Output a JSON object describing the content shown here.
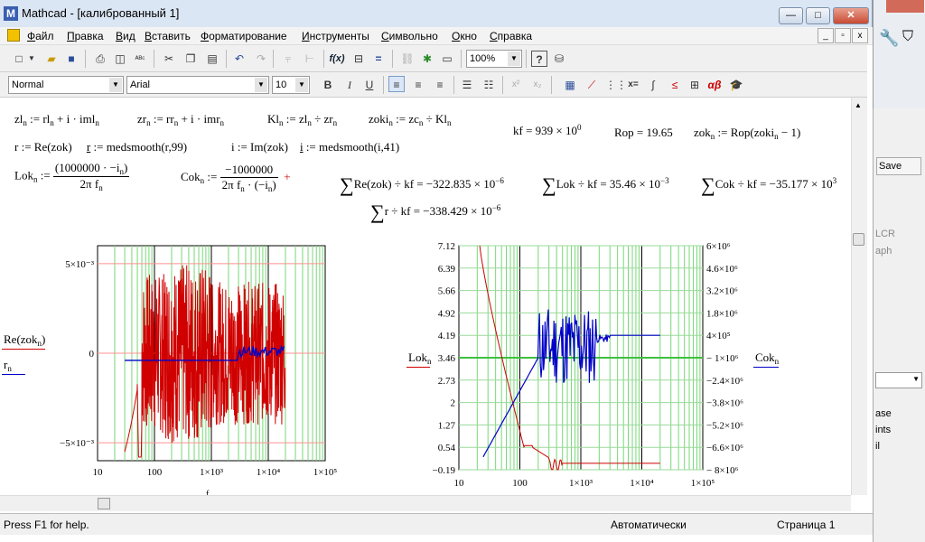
{
  "window": {
    "title": "Mathcad - [калиброванный 1]",
    "app_letter": "M",
    "min": "—",
    "max": "□",
    "close": "✕"
  },
  "menu": [
    {
      "k": "Ф",
      "r": "айл"
    },
    {
      "k": "П",
      "r": "равка"
    },
    {
      "k": "В",
      "r": "ид"
    },
    {
      "k": "В",
      "r": "ставить"
    },
    {
      "k": "Ф",
      "r": "орматирование"
    },
    {
      "k": "И",
      "r": "нструменты"
    },
    {
      "k": "С",
      "r": "имвольно"
    },
    {
      "k": "О",
      "r": "кно"
    },
    {
      "k": "С",
      "r": "правка"
    }
  ],
  "toolbar": {
    "zoom": "100%",
    "style": "Normal",
    "font": "Arial",
    "size": "10",
    "bold": "B",
    "italic": "I",
    "underline": "U"
  },
  "status": {
    "help": "Press F1 for help.",
    "mode": "Автоматически",
    "page": "Страница 1"
  },
  "browser": {
    "save": "Save",
    "lcr": "LCR",
    "aph": "aph",
    "ase": "ase",
    "ints": "ints",
    "il": "il"
  },
  "plot1": {
    "ylabel1": "Re(zok",
    "ylabel1_sub": "n",
    "ylabel2": "r",
    "ylabel2_sub": "n",
    "xlabel": "f"
  },
  "plot2": {
    "ylabel_left": "Lok",
    "ylabel_left_sub": "n",
    "ylabel_right": "Cok",
    "ylabel_right_sub": "n"
  },
  "chart_data": [
    {
      "type": "line",
      "x_scale": "log",
      "xlim": [
        10,
        100000
      ],
      "x_ticks": [
        "10",
        "100",
        "1×10³",
        "1×10⁴",
        "1×10⁵"
      ],
      "y_ticks": [
        "5×10⁻³",
        "0",
        "−5×10⁻³"
      ],
      "ylim": [
        -0.006,
        0.006
      ],
      "grid": true,
      "series": [
        {
          "name": "Re(zokn)",
          "color": "#d00000"
        },
        {
          "name": "rn",
          "color": "#0000c8"
        }
      ]
    },
    {
      "type": "line",
      "x_scale": "log",
      "xlim": [
        10,
        100000
      ],
      "x_ticks": [
        "10",
        "100",
        "1×10³",
        "1×10⁴",
        "1×10⁵"
      ],
      "y_ticks_left": [
        "7.12",
        "6.39",
        "5.66",
        "4.92",
        "4.19",
        "3.46",
        "2.73",
        "2",
        "1.27",
        "0.54",
        "−0.19"
      ],
      "y_ticks_right": [
        "6×10⁶",
        "4.6×10⁶",
        "3.2×10⁶",
        "1.8×10⁶",
        "4×10⁵",
        "− 1×10⁶",
        "−2.4×10⁶",
        "−3.8×10⁶",
        "−5.2×10⁶",
        "−6.6×10⁶",
        "− 8×10⁶"
      ],
      "grid": true,
      "series": [
        {
          "name": "Lokn",
          "color": "#d00000"
        },
        {
          "name": "Cokn",
          "color": "#0000c8"
        }
      ]
    }
  ]
}
